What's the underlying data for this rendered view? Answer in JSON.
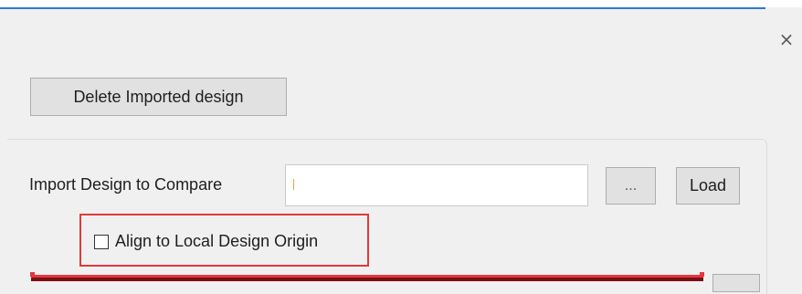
{
  "dialog": {
    "close_glyph": "×"
  },
  "buttons": {
    "delete_imported": "Delete Imported design",
    "browse": "...",
    "load": "Load"
  },
  "import": {
    "label": "Import Design to Compare",
    "path_value": "",
    "path_placeholder": ""
  },
  "options": {
    "align_label": "Align to Local Design Origin",
    "align_checked": false
  },
  "colors": {
    "window_bg": "#f0f0f0",
    "highlight_red": "#e0393e",
    "accent_blue": "#2b7bd0"
  },
  "icons": {
    "close": "close-icon"
  }
}
